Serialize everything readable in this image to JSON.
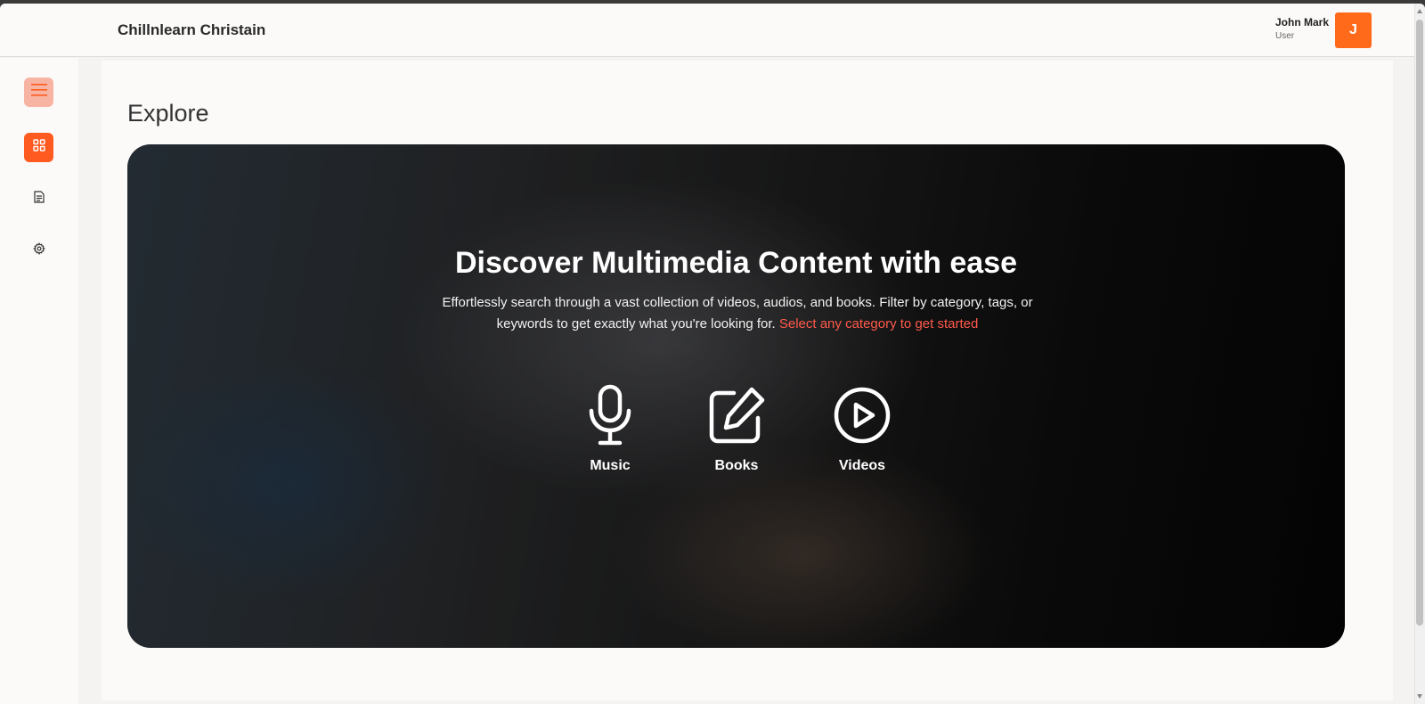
{
  "header": {
    "app_title": "Chillnlearn Christain",
    "user": {
      "name": "John Mark",
      "role": "User",
      "avatar_initial": "J"
    }
  },
  "sidebar": {
    "items": [
      {
        "icon": "hamburger-menu-icon"
      },
      {
        "icon": "dashboard-grid-icon",
        "active": true
      },
      {
        "icon": "document-icon"
      },
      {
        "icon": "gear-icon"
      }
    ]
  },
  "main": {
    "page_title": "Explore",
    "hero": {
      "title": "Discover Multimedia Content with ease",
      "subtitle": "Effortlessly search through a vast collection of videos, audios, and books. Filter by category, tags, or keywords to get exactly what you're looking for.",
      "cta_text": "Select any category to get started",
      "categories": [
        {
          "label": "Music",
          "icon": "microphone-icon"
        },
        {
          "label": "Books",
          "icon": "edit-icon"
        },
        {
          "label": "Videos",
          "icon": "play-circle-icon"
        }
      ]
    }
  },
  "colors": {
    "accent": "#ff5a1f",
    "avatar": "#ff6a1a",
    "cta": "#ff5a4a"
  }
}
